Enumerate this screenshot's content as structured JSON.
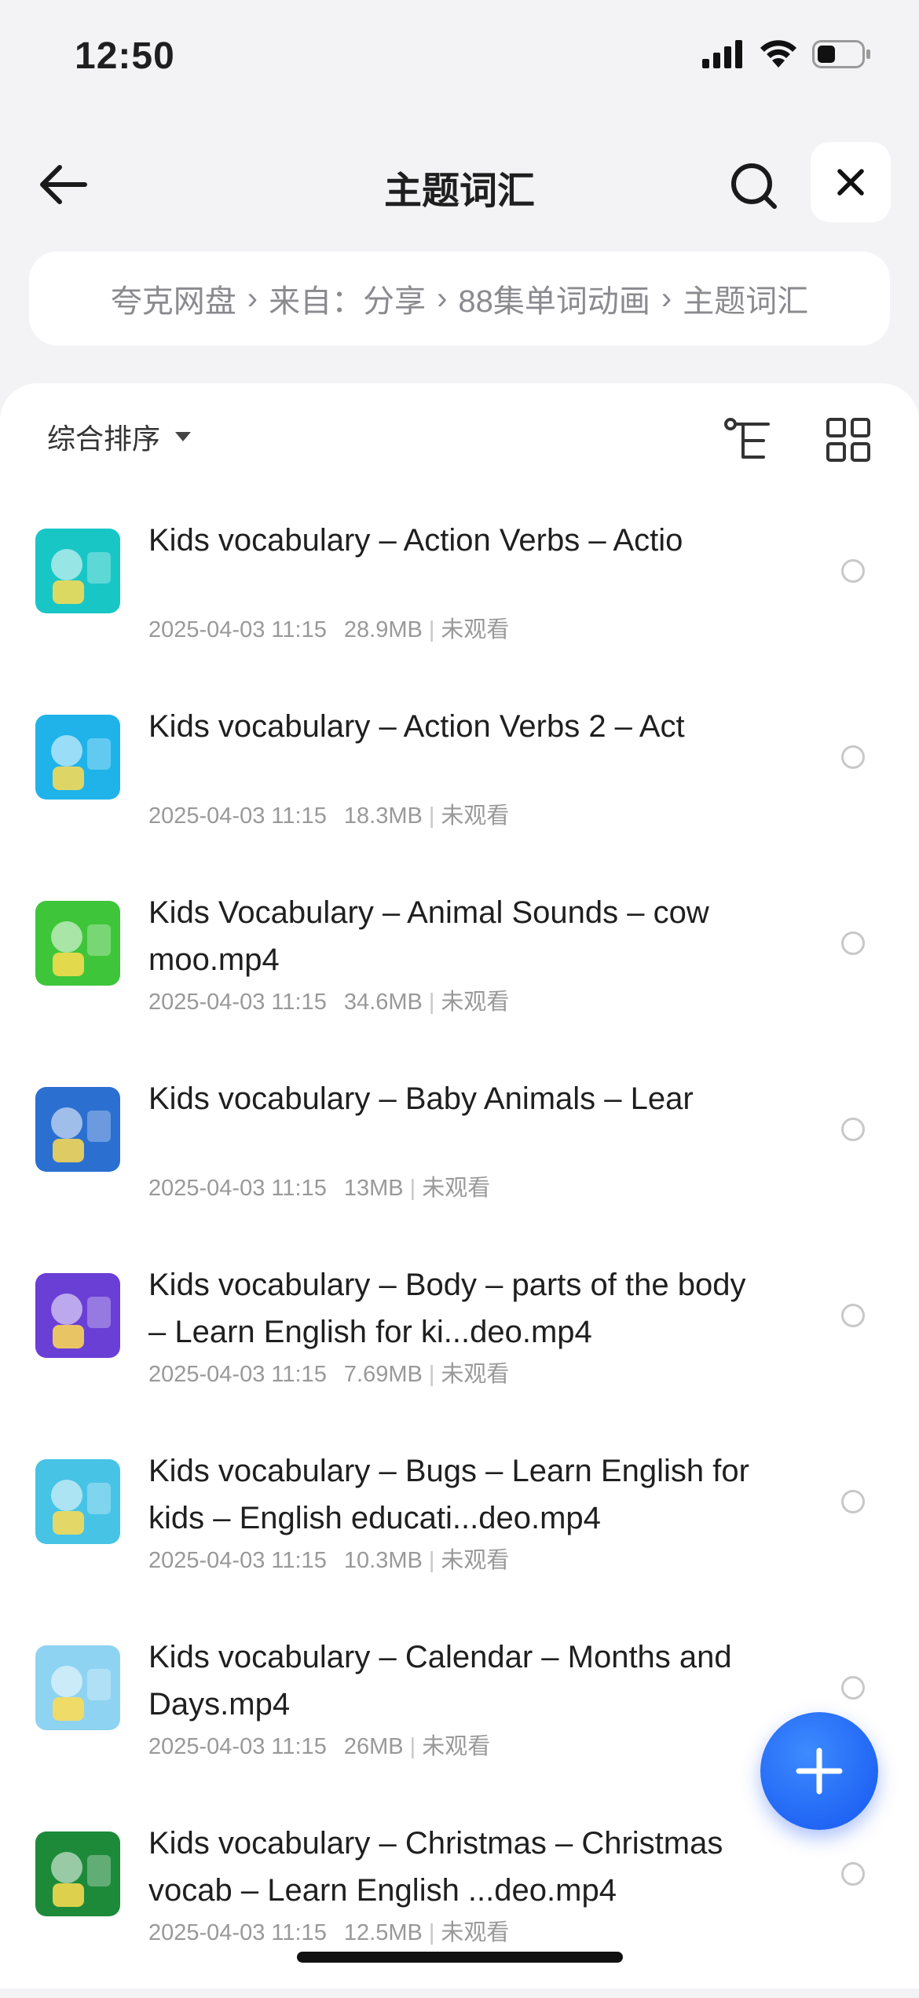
{
  "status_bar": {
    "time": "12:50"
  },
  "nav": {
    "title": "主题词汇"
  },
  "breadcrumb": {
    "items": [
      "夸克网盘",
      "来自：分享",
      "88集单词动画",
      "主题词汇"
    ]
  },
  "toolbar": {
    "sort_label": "综合排序"
  },
  "files": [
    {
      "name": "Kids vocabulary – Action Verbs – Actio",
      "date": "2025-04-03 11:15",
      "size": "28.9MB",
      "status": "未观看",
      "thumb_color": "#19c6c6"
    },
    {
      "name": "Kids vocabulary – Action Verbs 2 – Act",
      "date": "2025-04-03 11:15",
      "size": "18.3MB",
      "status": "未观看",
      "thumb_color": "#1fb3ea"
    },
    {
      "name": "Kids Vocabulary – Animal Sounds – cow moo.mp4",
      "date": "2025-04-03 11:15",
      "size": "34.6MB",
      "status": "未观看",
      "thumb_color": "#3fc53a"
    },
    {
      "name": "Kids vocabulary – Baby Animals – Lear",
      "date": "2025-04-03 11:15",
      "size": "13MB",
      "status": "未观看",
      "thumb_color": "#2b6fd1"
    },
    {
      "name": "Kids vocabulary – Body – parts of the body – Learn English for ki...deo.mp4",
      "date": "2025-04-03 11:15",
      "size": "7.69MB",
      "status": "未观看",
      "thumb_color": "#6a3fd6"
    },
    {
      "name": "Kids vocabulary – Bugs – Learn English for kids – English educati...deo.mp4",
      "date": "2025-04-03 11:15",
      "size": "10.3MB",
      "status": "未观看",
      "thumb_color": "#47c3e6"
    },
    {
      "name": "Kids vocabulary – Calendar – Months and Days.mp4",
      "date": "2025-04-03 11:15",
      "size": "26MB",
      "status": "未观看",
      "thumb_color": "#8fd3f2"
    },
    {
      "name": "Kids vocabulary – Christmas – Christmas vocab – Learn English ...deo.mp4",
      "date": "2025-04-03 11:15",
      "size": "12.5MB",
      "status": "未观看",
      "thumb_color": "#1d8a3a"
    }
  ]
}
